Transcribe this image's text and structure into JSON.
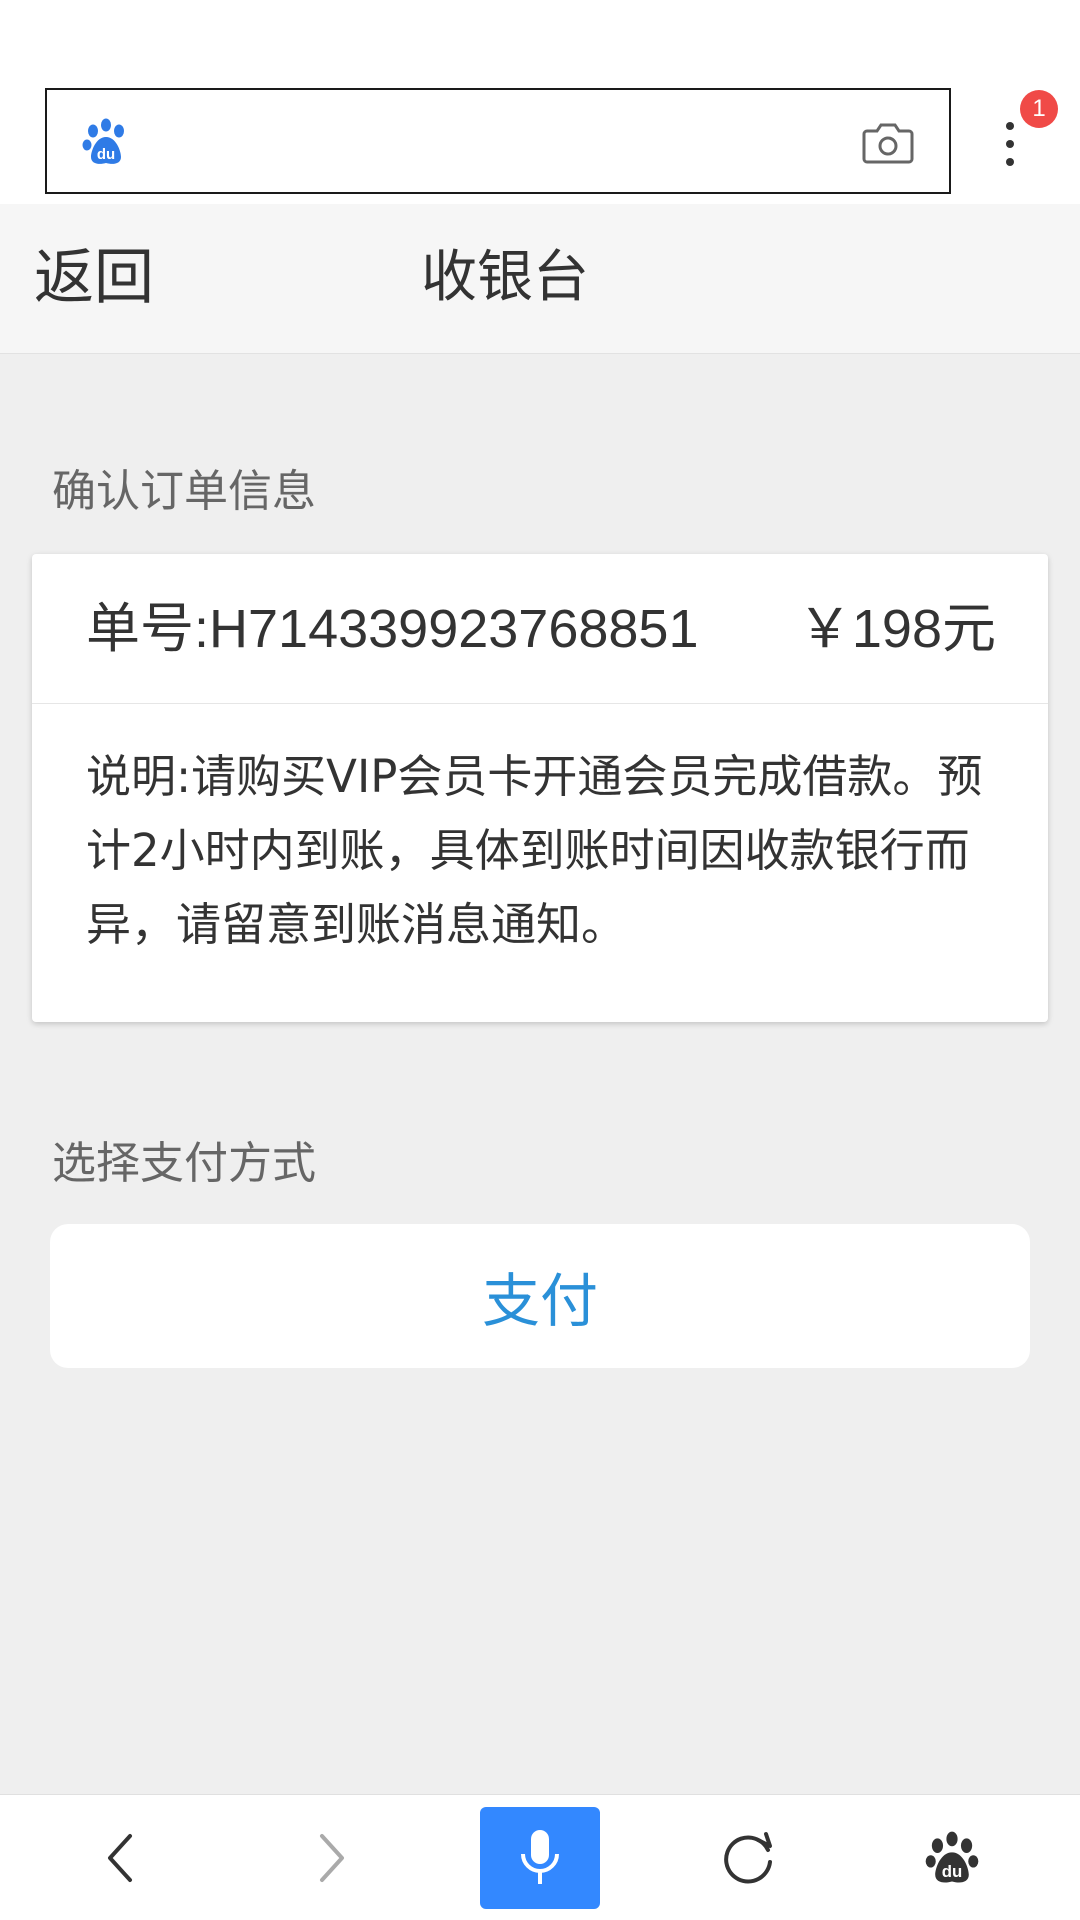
{
  "header": {
    "back_label": "返回",
    "title": "收银台"
  },
  "browser": {
    "notification_count": "1"
  },
  "order_section": {
    "label": "确认订单信息",
    "order_number": "单号:H714339923768851",
    "amount": "￥198元",
    "note": "说明:请购买VIP会员卡开通会员完成借款。预计2小时内到账，具体到账时间因收款银行而异，请留意到账消息通知。"
  },
  "payment_section": {
    "label": "选择支付方式",
    "pay_button_label": "支付"
  },
  "colors": {
    "accent": "#3388ff",
    "pay_text": "#2a90d8",
    "badge": "#f04a47"
  },
  "icons": {
    "address_logo": "baidu-paw-icon",
    "camera": "camera-icon",
    "menu": "more-vertical-icon",
    "nav_back": "chevron-left-icon",
    "nav_forward": "chevron-right-icon",
    "nav_voice": "microphone-icon",
    "nav_refresh": "refresh-icon",
    "nav_home": "baidu-paw-icon"
  }
}
